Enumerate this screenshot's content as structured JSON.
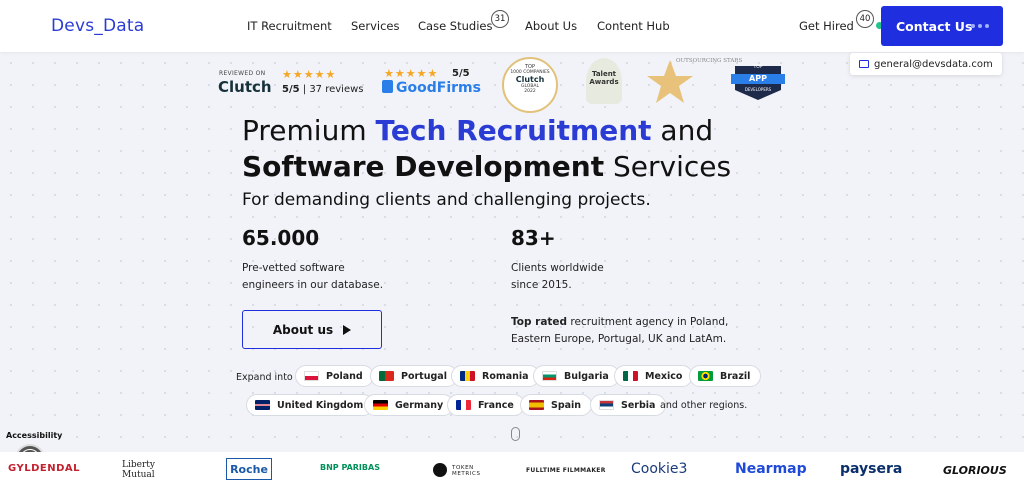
{
  "header": {
    "logo": "Devs_Data",
    "nav": [
      "IT Recruitment",
      "Services",
      "Case Studies",
      "About Us",
      "Content Hub"
    ],
    "case_studies_count": "31",
    "get_hired": "Get Hired",
    "get_hired_count": "40",
    "contact_button": "Contact Us",
    "email": "general@devsdata.com"
  },
  "reviews": {
    "clutch_label": "REVIEWED ON",
    "clutch_name": "Clutch",
    "clutch_score": "5/5",
    "clutch_reviews": "| 37 reviews",
    "goodfirms_score": "5/5",
    "goodfirms_name": "GoodFirms",
    "badge_clutch_top": "TOP",
    "badge_clutch_line": "1000 COMPANIES",
    "badge_clutch_name": "Clutch",
    "badge_clutch_global": "GLOBAL",
    "badge_clutch_year": "2022",
    "talent_awards": "Talent Awards",
    "outsourcing_stars": "OUTSOURCING STARS",
    "top_app_top": "TOP",
    "top_app_main": "APP",
    "top_app_sub": "DEVELOPERS"
  },
  "hero": {
    "line1_a": "Premium ",
    "line1_b": "Tech Recruitment",
    "line1_c": " and",
    "line2_a": "Software Development",
    "line2_b": " Services",
    "subtitle": "For demanding clients and challenging projects."
  },
  "stats": [
    {
      "number": "65.000",
      "line1": "Pre-vetted software",
      "line2": "engineers in our database."
    },
    {
      "number": "83+",
      "line1": "Clients worldwide",
      "line2": "since 2015."
    }
  ],
  "about_button": "About us",
  "top_rated": {
    "bold": "Top rated",
    "rest1": " recruitment agency in Poland,",
    "line2": "Eastern Europe, Portugal, UK and LatAm."
  },
  "expand_into": "Expand into",
  "countries_row1": [
    "Poland",
    "Portugal",
    "Romania",
    "Bulgaria",
    "Mexico",
    "Brazil"
  ],
  "countries_row2": [
    "United Kingdom",
    "Germany",
    "France",
    "Spain",
    "Serbia"
  ],
  "other_regions": "and other regions.",
  "accessibility": "Accessibility",
  "client_logos": [
    "GYLDENDAL",
    "Liberty Mutual",
    "Roche",
    "BNP PARIBAS",
    "TOKEN METRICS",
    "FULLTIME FILMMAKER",
    "Cookie3",
    "Nearmap",
    "paysera",
    "GLORIOUS"
  ],
  "colors": {
    "brand_blue": "#1f2fe0",
    "star": "#f5a623"
  }
}
